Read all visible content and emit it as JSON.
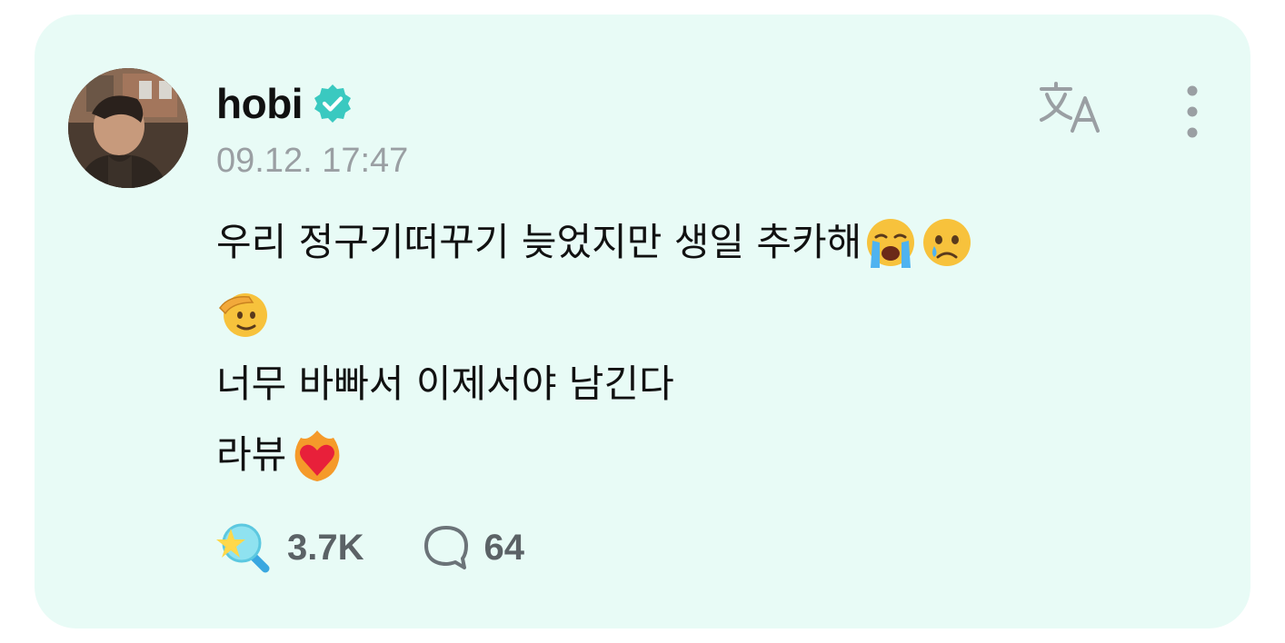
{
  "post": {
    "author": "hobi",
    "verified": true,
    "timestamp": "09.12. 17:47",
    "lines": [
      "우리 정구기떠꾸기 늦었지만 생일 추카해",
      "",
      "너무 바빠서 이제서야 남긴다",
      "라뷰"
    ],
    "emojis": {
      "line1": [
        "loudly-crying-face",
        "crying-face"
      ],
      "line2": [
        "saluting-face"
      ],
      "line4": [
        "heart-on-fire"
      ]
    }
  },
  "actions": {
    "cheer_count": "3.7K",
    "comment_count": "64"
  },
  "icons": {
    "translate": "translate-icon",
    "more": "more-vertical-icon",
    "verified": "verified-badge-icon",
    "cheer": "cheer-stick-icon",
    "comment": "comment-bubble-icon"
  },
  "colors": {
    "card_background": "#e8fbf6",
    "verified_badge": "#3ac9c0",
    "text_primary": "#111111",
    "text_secondary": "#9a9fa3",
    "counts": "#5b6266"
  }
}
